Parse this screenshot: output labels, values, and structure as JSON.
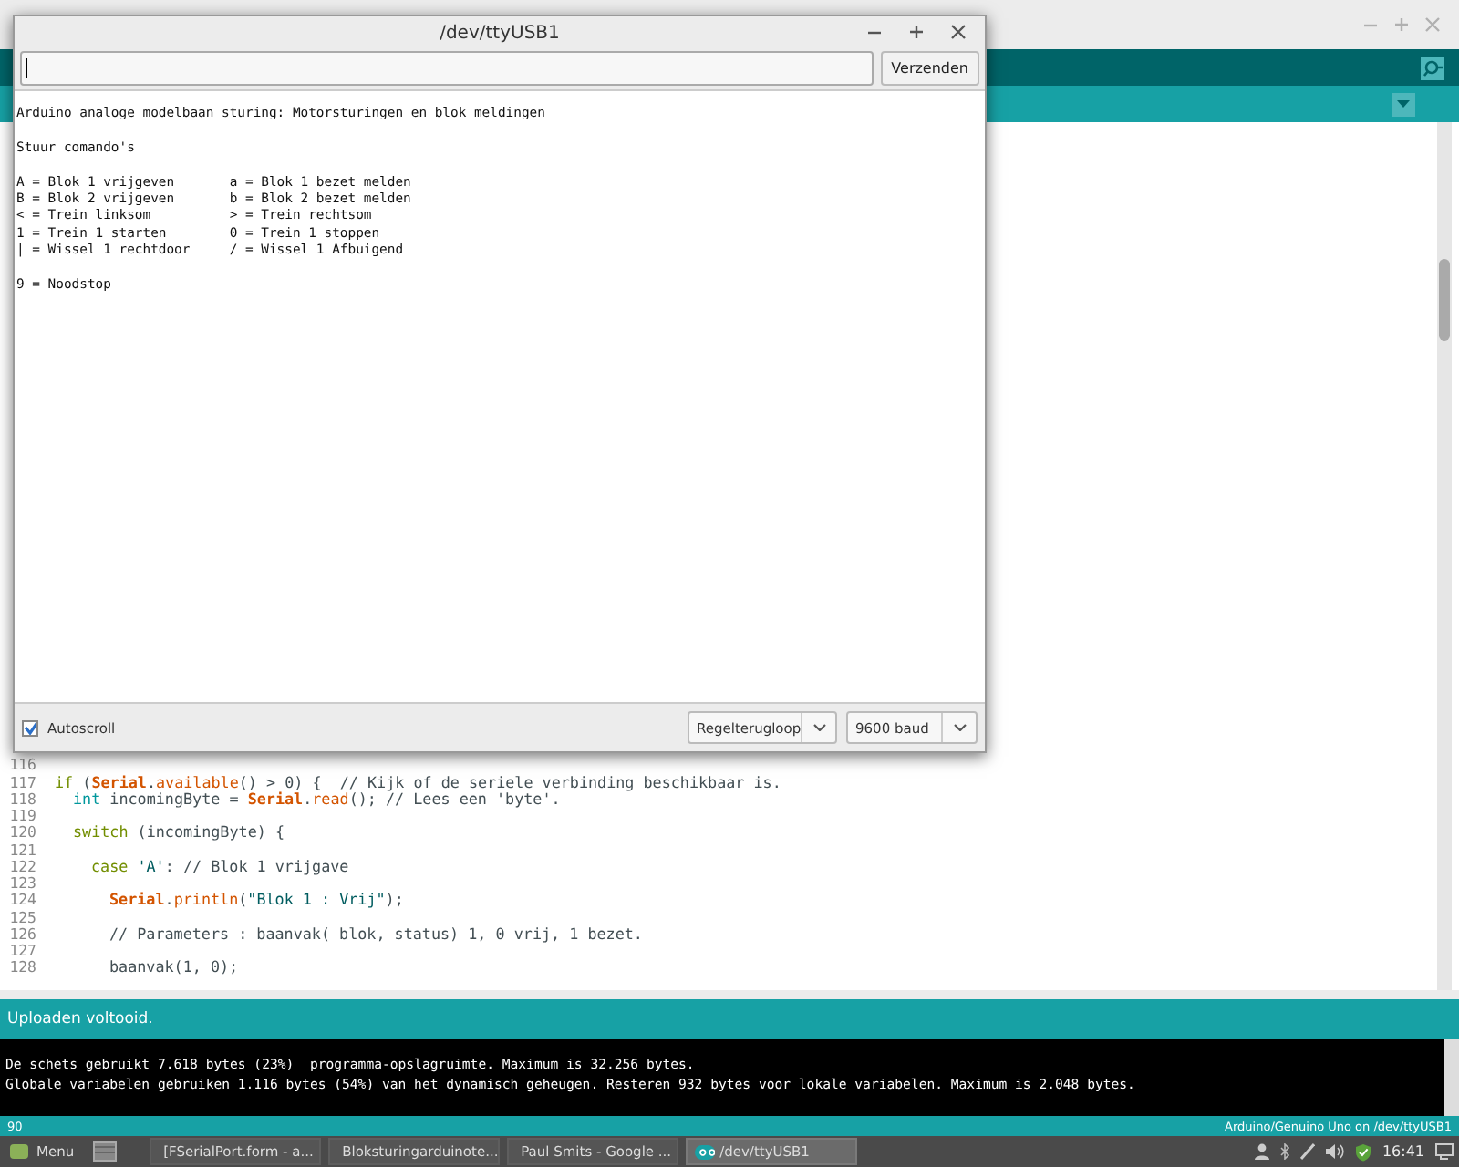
{
  "ide": {
    "code_lines": [
      {
        "number": "116"
      },
      {
        "number": "117",
        "segments": [
          {
            "kind": "keyword",
            "text": "if"
          },
          {
            "kind": "plain",
            "text": " ("
          },
          {
            "kind": "class",
            "text": "Serial"
          },
          {
            "kind": "plain",
            "text": "."
          },
          {
            "kind": "method",
            "text": "available"
          },
          {
            "kind": "plain",
            "text": "() > 0) {  "
          },
          {
            "kind": "comment",
            "text": "// Kijk of de seriele verbinding beschikbaar is."
          }
        ],
        "children": [
          {
            "number": "118",
            "segments": [
              {
                "kind": "type",
                "text": "int"
              },
              {
                "kind": "plain",
                "text": " incomingByte = "
              },
              {
                "kind": "class",
                "text": "Serial"
              },
              {
                "kind": "plain",
                "text": "."
              },
              {
                "kind": "method",
                "text": "read"
              },
              {
                "kind": "plain",
                "text": "(); "
              },
              {
                "kind": "comment",
                "text": "// Lees een 'byte'."
              }
            ]
          },
          {
            "number": "119"
          },
          {
            "number": "120",
            "segments": [
              {
                "kind": "keyword",
                "text": "switch"
              },
              {
                "kind": "plain",
                "text": " (incomingByte) {"
              }
            ],
            "children": [
              {
                "number": "121"
              },
              {
                "number": "122",
                "segments": [
                  {
                    "kind": "keyword",
                    "text": "case "
                  },
                  {
                    "kind": "string",
                    "text": "'A'"
                  },
                  {
                    "kind": "plain",
                    "text": ": "
                  },
                  {
                    "kind": "comment",
                    "text": "// Blok 1 vrijgave"
                  }
                ],
                "children": [
                  {
                    "number": "123"
                  },
                  {
                    "number": "124",
                    "segments": [
                      {
                        "kind": "class",
                        "text": "Serial"
                      },
                      {
                        "kind": "plain",
                        "text": "."
                      },
                      {
                        "kind": "method",
                        "text": "println"
                      },
                      {
                        "kind": "plain",
                        "text": "("
                      },
                      {
                        "kind": "string",
                        "text": "\"Blok 1 : Vrij\""
                      },
                      {
                        "kind": "plain",
                        "text": ");"
                      }
                    ]
                  },
                  {
                    "number": "125"
                  },
                  {
                    "number": "126",
                    "segments": [
                      {
                        "kind": "comment",
                        "text": "// Parameters : baanvak( blok, status) 1, 0 vrij, 1 bezet."
                      }
                    ]
                  },
                  {
                    "number": "127"
                  },
                  {
                    "number": "128",
                    "segments": [
                      {
                        "kind": "plain",
                        "text": "baanvak(1, 0);"
                      }
                    ]
                  }
                ]
              }
            ]
          }
        ]
      }
    ],
    "status_message": "Uploaden voltooid.",
    "console_lines": [
      "De schets gebruikt 7.618 bytes (23%)  programma-opslagruimte. Maximum is 32.256 bytes.",
      "Globale variabelen gebruiken 1.116 bytes (54%) van het dynamisch geheugen. Resteren 932 bytes voor lokale variabelen. Maximum is 2.048 bytes."
    ],
    "line_indicator": "90",
    "board": "Arduino/Genuino Uno on /dev/ttyUSB1"
  },
  "serial_monitor": {
    "title": "/dev/ttyUSB1",
    "send_button": "Verzenden",
    "output_blocks": [
      [
        "Arduino analoge modelbaan sturing: Motorsturingen en blok meldingen"
      ],
      [
        "Stuur comando's"
      ],
      [
        "A = Blok 1 vrijgeven       a = Blok 1 bezet melden",
        "B = Blok 2 vrijgeven       b = Blok 2 bezet melden",
        "< = Trein linksom          > = Trein rechtsom",
        "1 = Trein 1 starten        0 = Trein 1 stoppen",
        "| = Wissel 1 rechtdoor     / = Wissel 1 Afbuigend"
      ],
      [
        "9 = Noodstop"
      ]
    ],
    "autoscroll": {
      "label": "Autoscroll",
      "checked": true
    },
    "line_ending": "Regelterugloop",
    "baud": "9600 baud"
  },
  "taskbar": {
    "menu": "Menu",
    "tasks": [
      {
        "label": "[FSerialPort.form - a...",
        "kind": "generic",
        "selected": false
      },
      {
        "label": "Bloksturingarduinote...",
        "kind": "arduino",
        "selected": false
      },
      {
        "label": "Paul Smits - Google ...",
        "kind": "browser",
        "selected": false
      },
      {
        "label": "/dev/ttyUSB1",
        "kind": "arduino",
        "selected": true
      }
    ],
    "clock": "16:41"
  }
}
